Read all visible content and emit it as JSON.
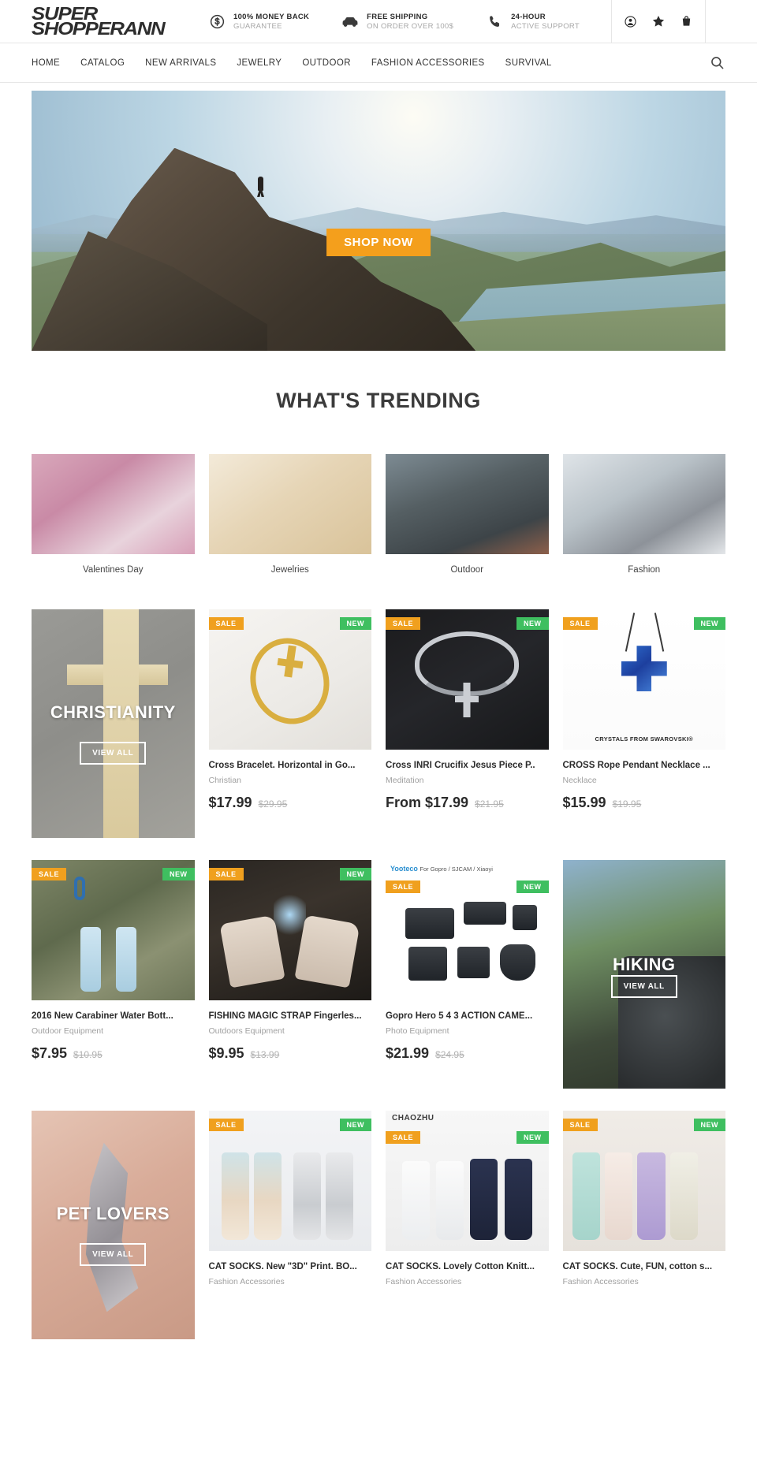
{
  "header": {
    "logo_line1": "SUPER",
    "logo_line2": "SHOPPERANN",
    "promos": [
      {
        "icon": "dollar-circle-icon",
        "title": "100% MONEY BACK",
        "sub": "GUARANTEE"
      },
      {
        "icon": "car-icon",
        "title": "FREE SHIPPING",
        "sub": "ON ORDER OVER 100$"
      },
      {
        "icon": "phone-icon",
        "title": "24-HOUR",
        "sub": "ACTIVE SUPPORT"
      }
    ],
    "account_icons": [
      "account-icon",
      "wishlist-star-icon",
      "cart-bag-icon"
    ]
  },
  "nav": {
    "items": [
      {
        "label": "HOME"
      },
      {
        "label": "CATALOG"
      },
      {
        "label": "NEW ARRIVALS"
      },
      {
        "label": "JEWELRY"
      },
      {
        "label": "OUTDOOR"
      },
      {
        "label": "FASHION ACCESSORIES"
      },
      {
        "label": "SURVIVAL"
      }
    ],
    "search_icon": "search-icon"
  },
  "hero": {
    "cta_label": "SHOP NOW"
  },
  "trending": {
    "title": "WHAT'S TRENDING",
    "cards": [
      {
        "label": "Valentines Day"
      },
      {
        "label": "Jewelries"
      },
      {
        "label": "Outdoor"
      },
      {
        "label": "Fashion"
      }
    ]
  },
  "collections": {
    "christianity": {
      "title": "CHRISTIANITY",
      "view_all": "VIEW ALL"
    },
    "hiking": {
      "title": "HIKING",
      "view_all": "VIEW ALL"
    },
    "pet_lovers": {
      "title": "PET LOVERS",
      "view_all": "VIEW ALL"
    }
  },
  "badges": {
    "sale": "SALE",
    "new": "NEW"
  },
  "products": {
    "row1": [
      {
        "title": "Cross Bracelet. Horizontal in Go...",
        "vendor": "Christian",
        "price": "$17.99",
        "compare_at": "$29.95",
        "badge_sale": "SALE",
        "badge_new": "NEW"
      },
      {
        "title": "Cross INRI Crucifix Jesus Piece P..",
        "vendor": "Meditation",
        "price": "From $17.99",
        "compare_at": "$21.95",
        "badge_sale": "SALE",
        "badge_new": "NEW"
      },
      {
        "title": "CROSS Rope Pendant Necklace ...",
        "vendor": "Necklace",
        "price": "$15.99",
        "compare_at": "$19.95",
        "badge_sale": "SALE",
        "badge_new": "NEW",
        "image_caption": "CRYSTALS FROM SWAROVSKI®"
      }
    ],
    "row2": [
      {
        "title": "2016 New Carabiner Water Bott...",
        "vendor": "Outdoor Equipment",
        "price": "$7.95",
        "compare_at": "$10.95",
        "badge_sale": "SALE",
        "badge_new": "NEW"
      },
      {
        "title": "FISHING MAGIC STRAP Fingerles...",
        "vendor": "Outdoors Equipment",
        "price": "$9.95",
        "compare_at": "$13.99",
        "badge_sale": "SALE",
        "badge_new": "NEW"
      },
      {
        "title": "Gopro Hero 5 4 3 ACTION CAME...",
        "vendor": "Photo Equipment",
        "price": "$21.99",
        "compare_at": "$24.95",
        "badge_sale": "SALE",
        "badge_new": "NEW",
        "image_caption": "Yooteco",
        "image_caption2": "For Gopro / SJCAM / Xiaoyi"
      }
    ],
    "row3": [
      {
        "title": "CAT SOCKS. New \"3D\" Print. BO...",
        "vendor": "Fashion Accessories",
        "badge_sale": "SALE",
        "badge_new": "NEW"
      },
      {
        "title": "CAT SOCKS. Lovely Cotton Knitt...",
        "vendor": "Fashion Accessories",
        "badge_sale": "SALE",
        "badge_new": "NEW",
        "image_caption": "CHAOZHU"
      },
      {
        "title": "CAT SOCKS. Cute, FUN, cotton s...",
        "vendor": "Fashion Accessories",
        "badge_sale": "SALE",
        "badge_new": "NEW"
      }
    ]
  },
  "colors": {
    "sale_badge": "#F0A01E",
    "new_badge": "#3FBF60",
    "cta_orange": "#F49F1C",
    "text_dark": "#2b2b2b",
    "text_muted": "#a0a0a0"
  }
}
